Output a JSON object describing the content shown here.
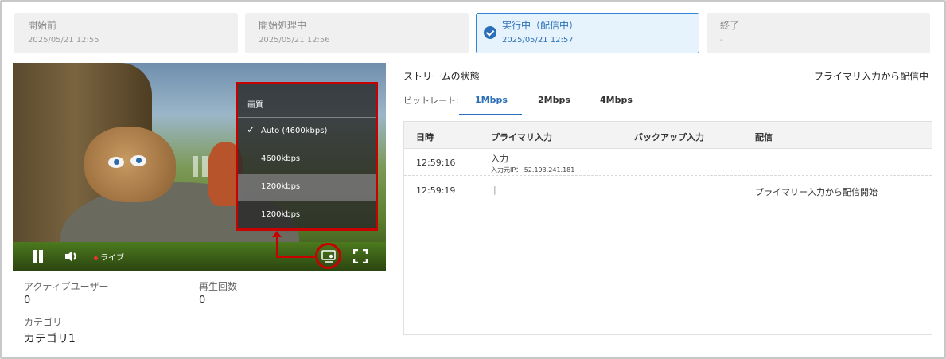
{
  "steps": [
    {
      "title": "開始前",
      "date": "2025/05/21 12:55"
    },
    {
      "title": "開始処理中",
      "date": "2025/05/21 12:56"
    },
    {
      "title": "実行中（配信中）",
      "date": "2025/05/21 12:57"
    },
    {
      "title": "終了",
      "date": "-"
    }
  ],
  "player": {
    "live_label": "ライブ",
    "quality_menu": {
      "title": "画質",
      "options": [
        "Auto (4600kbps)",
        "4600kbps",
        "1200kbps",
        "1200kbps"
      ],
      "selected": "Auto (4600kbps)",
      "highlighted_index": 2
    },
    "icons": [
      "pause-icon",
      "volume-icon",
      "settings-icon",
      "fullscreen-icon"
    ]
  },
  "stats": {
    "active_users_label": "アクティブユーザー",
    "active_users": "0",
    "play_count_label": "再生回数",
    "play_count": "0",
    "category_label": "カテゴリ",
    "category": "カテゴリ1"
  },
  "stream": {
    "title": "ストリームの状態",
    "status": "プライマリ入力から配信中",
    "bitrate_label": "ビットレート:",
    "tabs": [
      "1Mbps",
      "2Mbps",
      "4Mbps"
    ],
    "active_tab": "1Mbps",
    "columns": [
      "日時",
      "プライマリ入力",
      "バックアップ入力",
      "配信"
    ],
    "rows": [
      {
        "time": "12:59:16",
        "primary": "入力",
        "primary_sub": "入力元IP： 52.193.241.181",
        "backup": "",
        "delivery": ""
      },
      {
        "time": "12:59:19",
        "primary": "|",
        "primary_sub": "",
        "backup": "",
        "delivery": "プライマリー入力から配信開始"
      }
    ]
  },
  "colors": {
    "accent": "#2a6fb8",
    "annotation": "#c80000"
  }
}
